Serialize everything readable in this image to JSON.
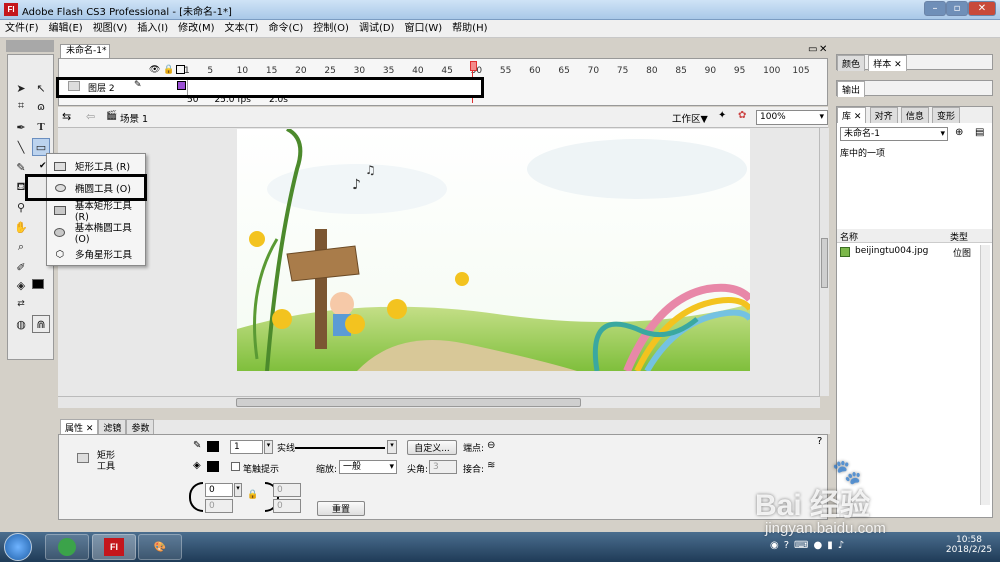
{
  "window": {
    "title": "Adobe Flash CS3 Professional - [未命名-1*]",
    "logo": "Fl"
  },
  "menu": [
    "文件(F)",
    "编辑(E)",
    "视图(V)",
    "插入(I)",
    "修改(M)",
    "文本(T)",
    "命令(C)",
    "控制(O)",
    "调试(D)",
    "窗口(W)",
    "帮助(H)"
  ],
  "document_tab": "未命名-1*",
  "timeline": {
    "ruler": [
      "1",
      "5",
      "10",
      "15",
      "20",
      "25",
      "30",
      "35",
      "40",
      "45",
      "50",
      "55",
      "60",
      "65",
      "70",
      "75",
      "80",
      "85",
      "90",
      "95",
      "100",
      "105"
    ],
    "layer_name": "图层 2",
    "status": {
      "frame": "50",
      "fps": "25.0 fps",
      "time": "2.0s"
    }
  },
  "scene": {
    "name": "场景 1",
    "workspace": "工作区▼",
    "zoom": "100%"
  },
  "context_menu": {
    "items": [
      {
        "label": "矩形工具 (R)",
        "checked": true
      },
      {
        "label": "椭圆工具 (O)",
        "checked": false
      },
      {
        "label": "基本矩形工具(R)",
        "checked": false
      },
      {
        "label": "基本椭圆工具(O)",
        "checked": false
      },
      {
        "label": "多角星形工具",
        "checked": false
      }
    ]
  },
  "properties": {
    "tabs": [
      "属性",
      "滤镜",
      "参数"
    ],
    "tool_name_1": "矩形",
    "tool_name_2": "工具",
    "stroke_width": "1",
    "stroke_style": "实线",
    "custom_button": "自定义...",
    "cap_label": "端点:",
    "hint_label": "笔触提示",
    "scale_label": "缩放:",
    "scale_value": "一般",
    "miter_label": "尖角:",
    "miter_value": "3",
    "join_label": "接合:",
    "corner_values": [
      "0",
      "0",
      "0",
      "0"
    ],
    "reset_button": "重置"
  },
  "right_panels": {
    "color_tabs": [
      "颜色",
      "样本"
    ],
    "output_tab": "输出",
    "library_tabs": [
      "库",
      "对齐",
      "信息",
      "变形"
    ],
    "library_doc": "未命名-1",
    "library_count": "库中的一项",
    "col_name": "名称",
    "col_type": "类型",
    "item_name": "beijingtu004.jpg",
    "item_type": "位图"
  },
  "taskbar": {
    "time": "10:58",
    "date": "2018/2/25"
  },
  "watermark": {
    "brand": "Bai 经验",
    "url": "jingyan.baidu.com"
  },
  "colors": {
    "flash_red": "#c4161c",
    "selection_box": "#000000",
    "playhead": "#e03030"
  }
}
